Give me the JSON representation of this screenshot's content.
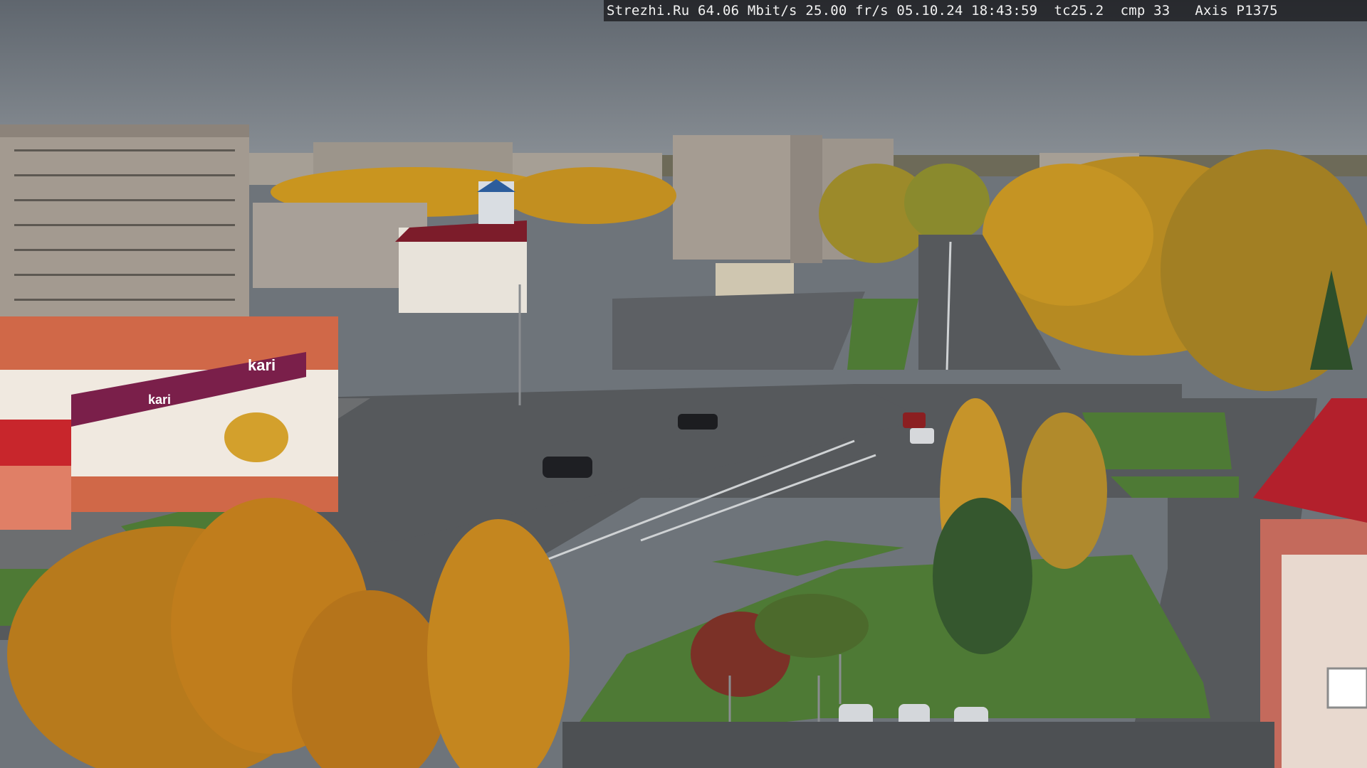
{
  "overlay": {
    "text": "Strezhi.Ru 64.06 Mbit/s 25.00 fr/s 05.10.24 18:43:59  tc25.2  cmp 33   Axis P1375"
  },
  "signs": {
    "store": "kari",
    "store_left": "kari"
  },
  "colors": {
    "sky": "#6f777f",
    "asphalt": "#55595d",
    "grass": "#4e7a35",
    "foliage": "#c9921f",
    "store_facade": "#7a1f4a",
    "roof_red": "#b3202c"
  }
}
